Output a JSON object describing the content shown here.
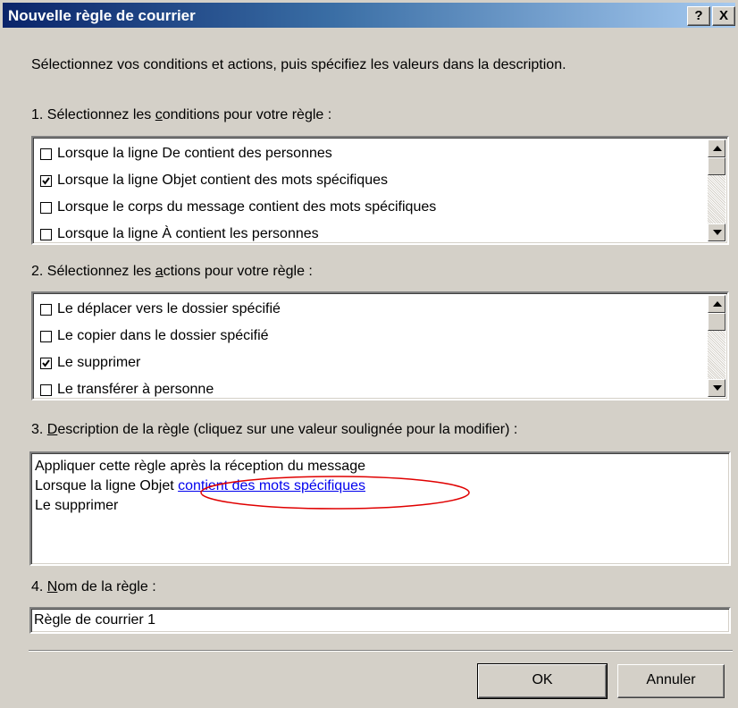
{
  "dialog": {
    "title": "Nouvelle règle de courrier",
    "help_label": "?",
    "close_label": "X",
    "intro": "Sélectionnez vos conditions et actions, puis spécifiez les valeurs dans la description."
  },
  "conditions": {
    "label_prefix": "1. Sélectionnez les ",
    "label_accel": "c",
    "label_suffix": "onditions pour votre règle :",
    "items": [
      {
        "label": "Lorsque la ligne De contient des personnes",
        "checked": false
      },
      {
        "label": "Lorsque la ligne Objet contient des mots spécifiques",
        "checked": true
      },
      {
        "label": "Lorsque le corps du message contient des mots spécifiques",
        "checked": false
      },
      {
        "label": "Lorsque la ligne À contient les personnes",
        "checked": false
      }
    ]
  },
  "actions": {
    "label_prefix": "2. Sélectionnez les ",
    "label_accel": "a",
    "label_suffix": "ctions pour votre règle :",
    "items": [
      {
        "label": "Le déplacer vers le dossier spécifié",
        "checked": false
      },
      {
        "label": "Le copier dans le dossier spécifié",
        "checked": false
      },
      {
        "label": "Le supprimer",
        "checked": true
      },
      {
        "label": "Le transférer à personne",
        "checked": false
      }
    ]
  },
  "description": {
    "label_prefix": "3. ",
    "label_accel": "D",
    "label_suffix": "escription de la règle (cliquez sur une valeur soulignée pour la modifier) :",
    "line1": "Appliquer cette règle après la réception du message",
    "line2_prefix": "Lorsque la ligne Objet ",
    "line2_link": "contient des mots spécifiques",
    "line3": "Le supprimer",
    "highlight_color": "#e00000"
  },
  "name": {
    "label_prefix": "4. ",
    "label_accel": "N",
    "label_suffix": "om de la règle :",
    "value": "Règle de courrier 1"
  },
  "buttons": {
    "ok": "OK",
    "cancel": "Annuler"
  }
}
